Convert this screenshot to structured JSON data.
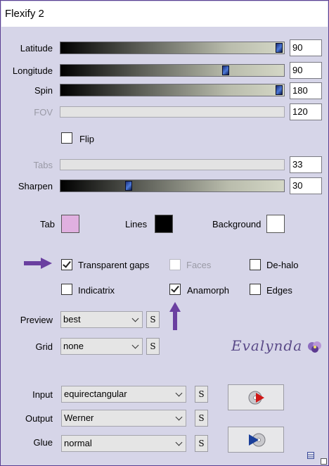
{
  "window": {
    "title": "Flexify 2"
  },
  "sliders": [
    {
      "label": "Latitude",
      "value": "90",
      "fraction": 1.0,
      "enabled": true
    },
    {
      "label": "Longitude",
      "value": "90",
      "fraction": 0.75,
      "enabled": true
    },
    {
      "label": "Spin",
      "value": "180",
      "fraction": 1.0,
      "enabled": true
    },
    {
      "label": "FOV",
      "value": "120",
      "fraction": null,
      "enabled": false
    },
    {
      "label": "Tabs",
      "value": "33",
      "fraction": null,
      "enabled": false
    },
    {
      "label": "Sharpen",
      "value": "30",
      "fraction": 0.3,
      "enabled": true
    }
  ],
  "flip": {
    "label": "Flip",
    "checked": false
  },
  "colors": {
    "tab": {
      "label": "Tab",
      "color": "#e0b0e0"
    },
    "lines": {
      "label": "Lines",
      "color": "#000000"
    },
    "background": {
      "label": "Background",
      "color": "#ffffff"
    }
  },
  "options": {
    "transparent_gaps": {
      "label": "Transparent gaps",
      "checked": true
    },
    "faces": {
      "label": "Faces",
      "checked": false,
      "enabled": false
    },
    "dehalo": {
      "label": "De-halo",
      "checked": false
    },
    "indicatrix": {
      "label": "Indicatrix",
      "checked": false
    },
    "anamorph": {
      "label": "Anamorph",
      "checked": true
    },
    "edges": {
      "label": "Edges",
      "checked": false
    }
  },
  "preview": {
    "label": "Preview",
    "value": "best"
  },
  "grid": {
    "label": "Grid",
    "value": "none"
  },
  "logo_text": "Evalynda",
  "input": {
    "label": "Input",
    "value": "equirectangular"
  },
  "output": {
    "label": "Output",
    "value": "Werner"
  },
  "glue": {
    "label": "Glue",
    "value": "normal"
  },
  "s_button_label": "S",
  "accent": "#6a3fa0"
}
